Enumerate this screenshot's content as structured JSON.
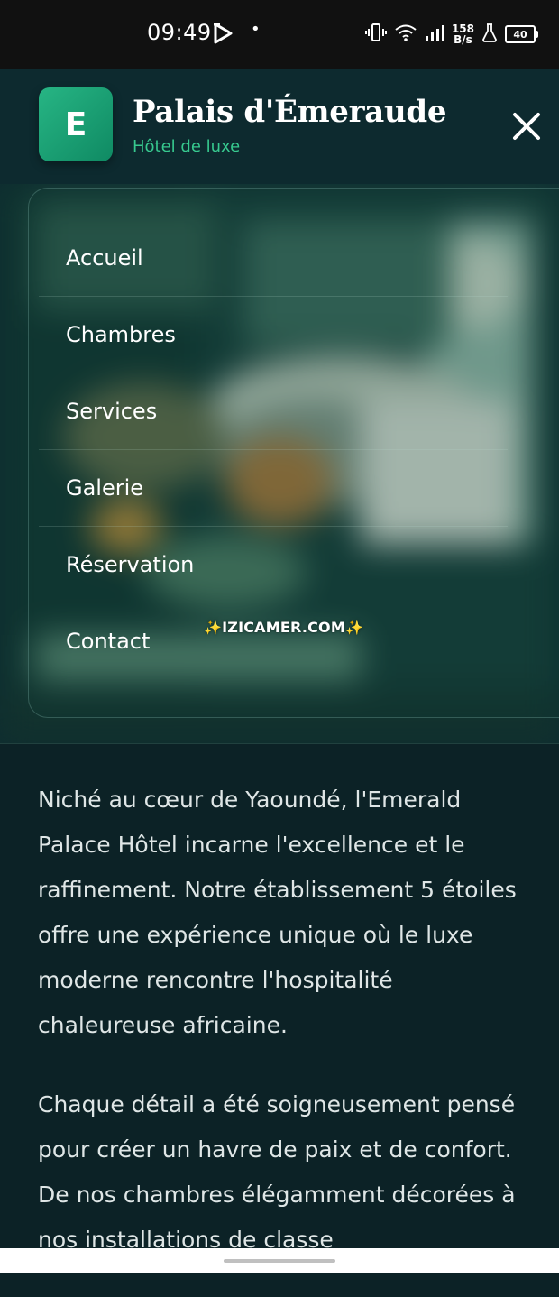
{
  "status_bar": {
    "time": "09:49",
    "dot": "•",
    "net_speed_value": "158",
    "net_speed_unit": "B/s",
    "battery": "40"
  },
  "header": {
    "logo_letter": "E",
    "title": "Palais d'Émeraude",
    "tagline": "Hôtel de luxe"
  },
  "menu": {
    "items": [
      {
        "label": "Accueil"
      },
      {
        "label": "Chambres"
      },
      {
        "label": "Services"
      },
      {
        "label": "Galerie"
      },
      {
        "label": "Réservation"
      },
      {
        "label": "Contact"
      }
    ]
  },
  "watermark": "✨IZICAMER.COM✨",
  "content": {
    "paragraph_1": "Niché au cœur de Yaoundé, l'Emerald Palace Hôtel incarne l'excellence et le raffinement. Notre établissement 5 étoiles offre une expérience unique où le luxe moderne rencontre l'hospitalité chaleureuse africaine.",
    "paragraph_2": "Chaque détail a été soigneusement pensé pour créer un havre de paix et de confort. De nos chambres élégamment décorées à nos installations de classe"
  },
  "colors": {
    "accent": "#2fbf8a",
    "background": "#0c2226",
    "header_bg": "#0d2a2f"
  }
}
